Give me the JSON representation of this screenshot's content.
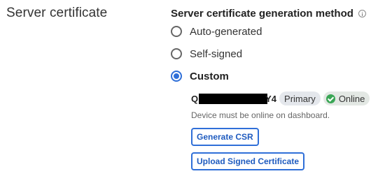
{
  "section": {
    "title": "Server certificate"
  },
  "method": {
    "title": "Server certificate generation method",
    "info_icon": "info-icon",
    "options": [
      {
        "label": "Auto-generated",
        "selected": false
      },
      {
        "label": "Self-signed",
        "selected": false
      },
      {
        "label": "Custom",
        "selected": true
      }
    ]
  },
  "custom": {
    "device_prefix": "Q",
    "device_suffix": "Y4",
    "badges": {
      "primary": "Primary",
      "online": "Online"
    },
    "help_text": "Device must be online on dashboard.",
    "generate_csr_label": "Generate CSR",
    "upload_label": "Upload Signed Certificate"
  },
  "colors": {
    "accent": "#2f6fd8",
    "online_green": "#3aa655"
  }
}
